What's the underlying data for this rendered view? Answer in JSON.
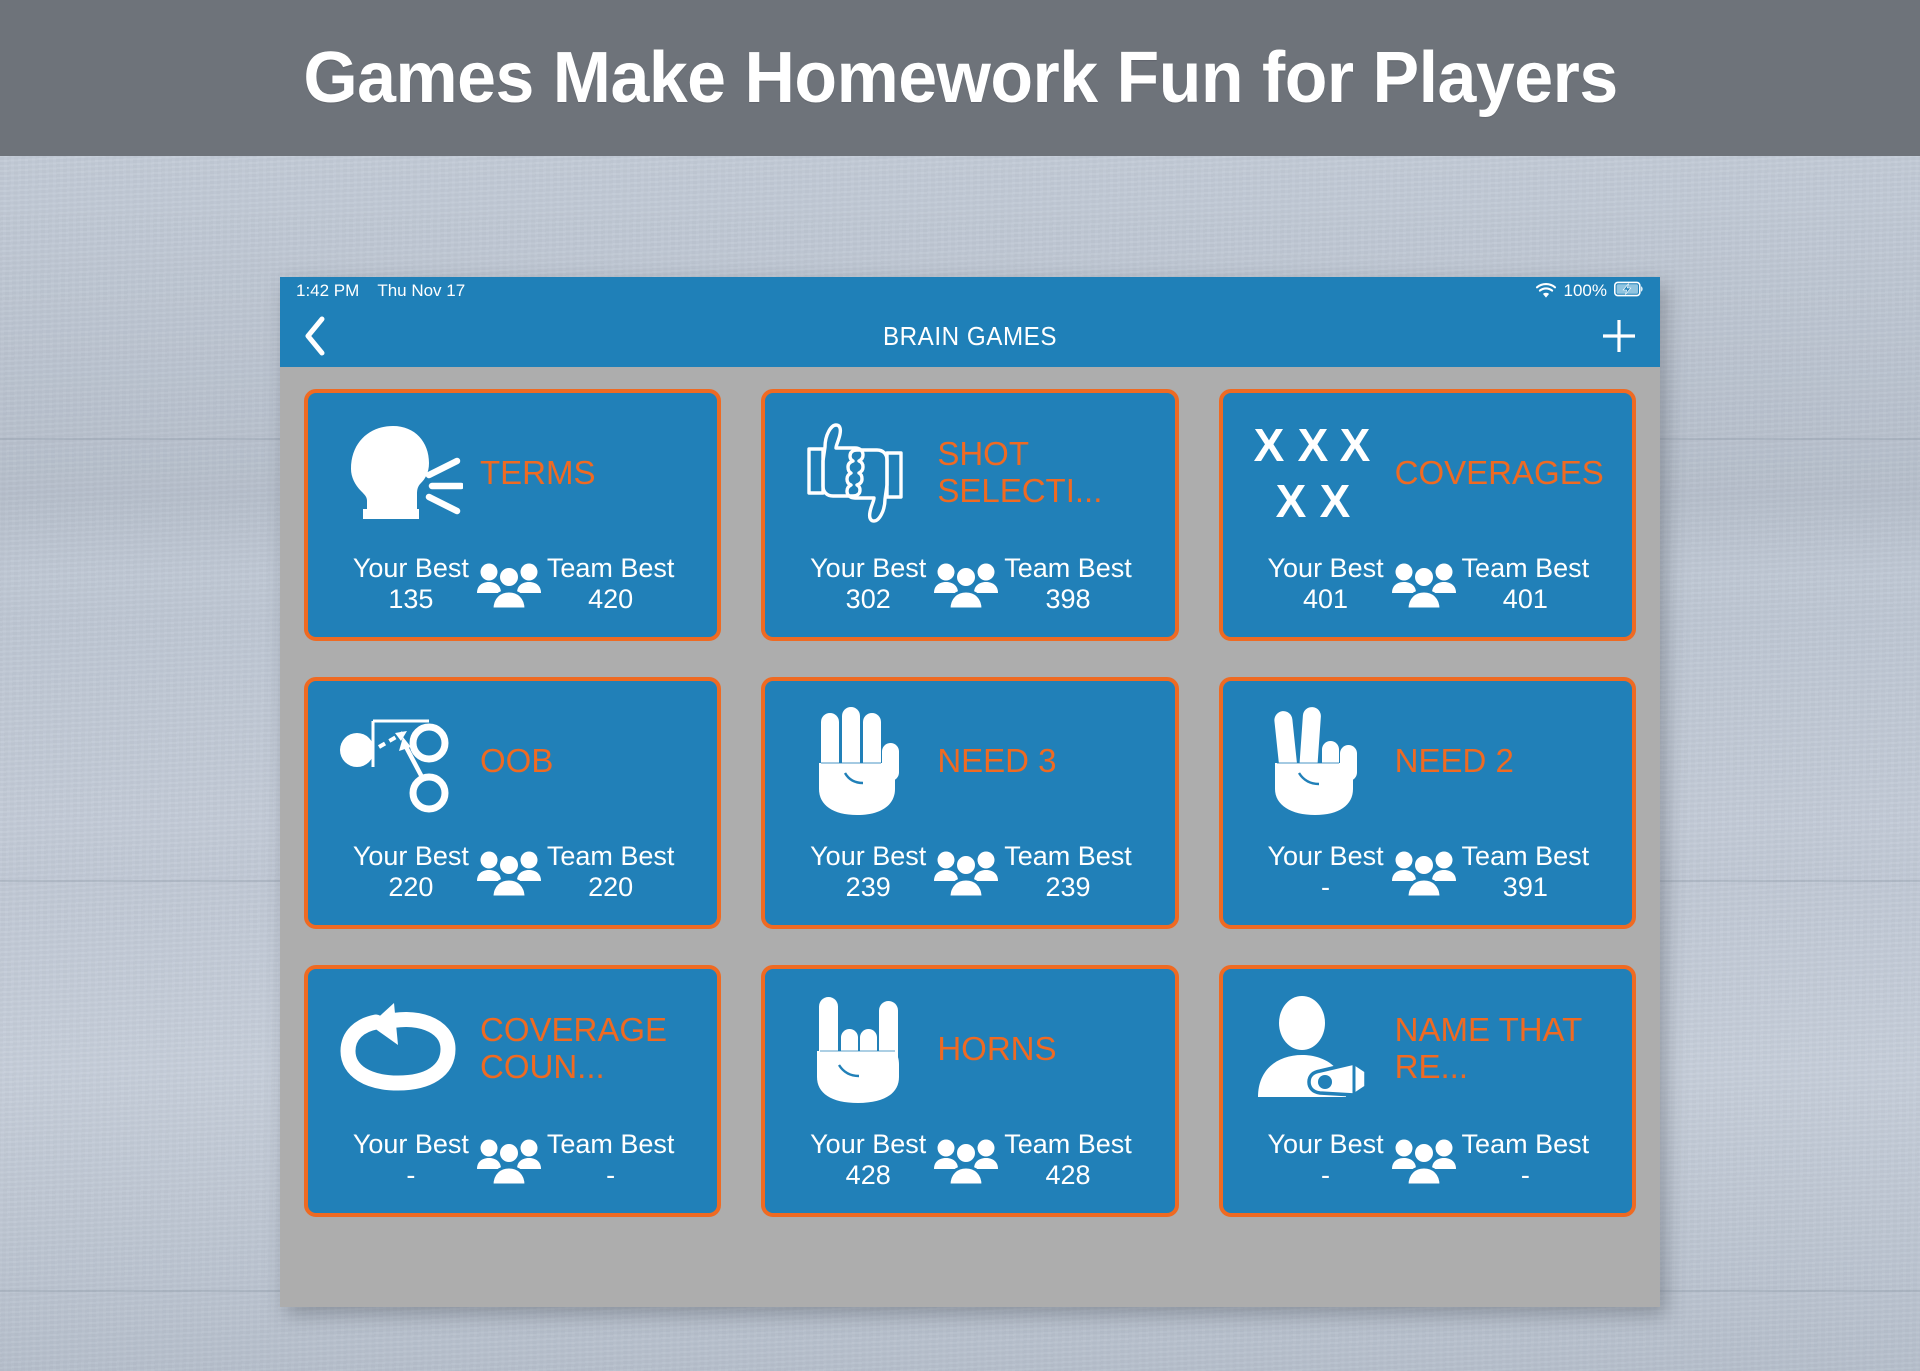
{
  "banner": {
    "title": "Games Make Homework Fun for Players",
    "background": "#6e737a",
    "text_color": "#ffffff"
  },
  "theme": {
    "blue": "#2180b8",
    "orange": "#ef6a22",
    "device_gray": "#adadad",
    "white": "#ffffff"
  },
  "device": {
    "status_bar": {
      "time": "1:42 PM",
      "date": "Thu Nov 17",
      "wifi_icon": "wifi-icon",
      "battery_percent": "100%",
      "battery_icon": "battery-charging-icon"
    },
    "nav_bar": {
      "back_icon": "chevron-left-icon",
      "title": "BRAIN GAMES",
      "add_icon": "plus-icon"
    },
    "stats_labels": {
      "your_best": "Your Best",
      "team_best": "Team Best",
      "group_icon": "people-group-icon"
    },
    "games": [
      {
        "title": "TERMS",
        "icon": "speaking-head-icon",
        "your_best": "135",
        "team_best": "420"
      },
      {
        "title": "SHOT SELECTI...",
        "icon": "thumbs-up-down-icon",
        "your_best": "302",
        "team_best": "398"
      },
      {
        "title": "COVERAGES",
        "icon": "x-formation-icon",
        "your_best": "401",
        "team_best": "401"
      },
      {
        "title": "OOB",
        "icon": "out-of-bounds-play-diagram-icon",
        "your_best": "220",
        "team_best": "220"
      },
      {
        "title": "NEED 3",
        "icon": "hand-three-fingers-icon",
        "your_best": "239",
        "team_best": "239"
      },
      {
        "title": "NEED 2",
        "icon": "hand-two-fingers-icon",
        "your_best": "-",
        "team_best": "391"
      },
      {
        "title": "COVERAGE COUN...",
        "icon": "loop-arrow-icon",
        "your_best": "-",
        "team_best": "-"
      },
      {
        "title": "HORNS",
        "icon": "hand-horns-icon",
        "your_best": "428",
        "team_best": "428"
      },
      {
        "title": "NAME THAT RE...",
        "icon": "referee-whistle-person-icon",
        "your_best": "-",
        "team_best": "-"
      }
    ]
  }
}
